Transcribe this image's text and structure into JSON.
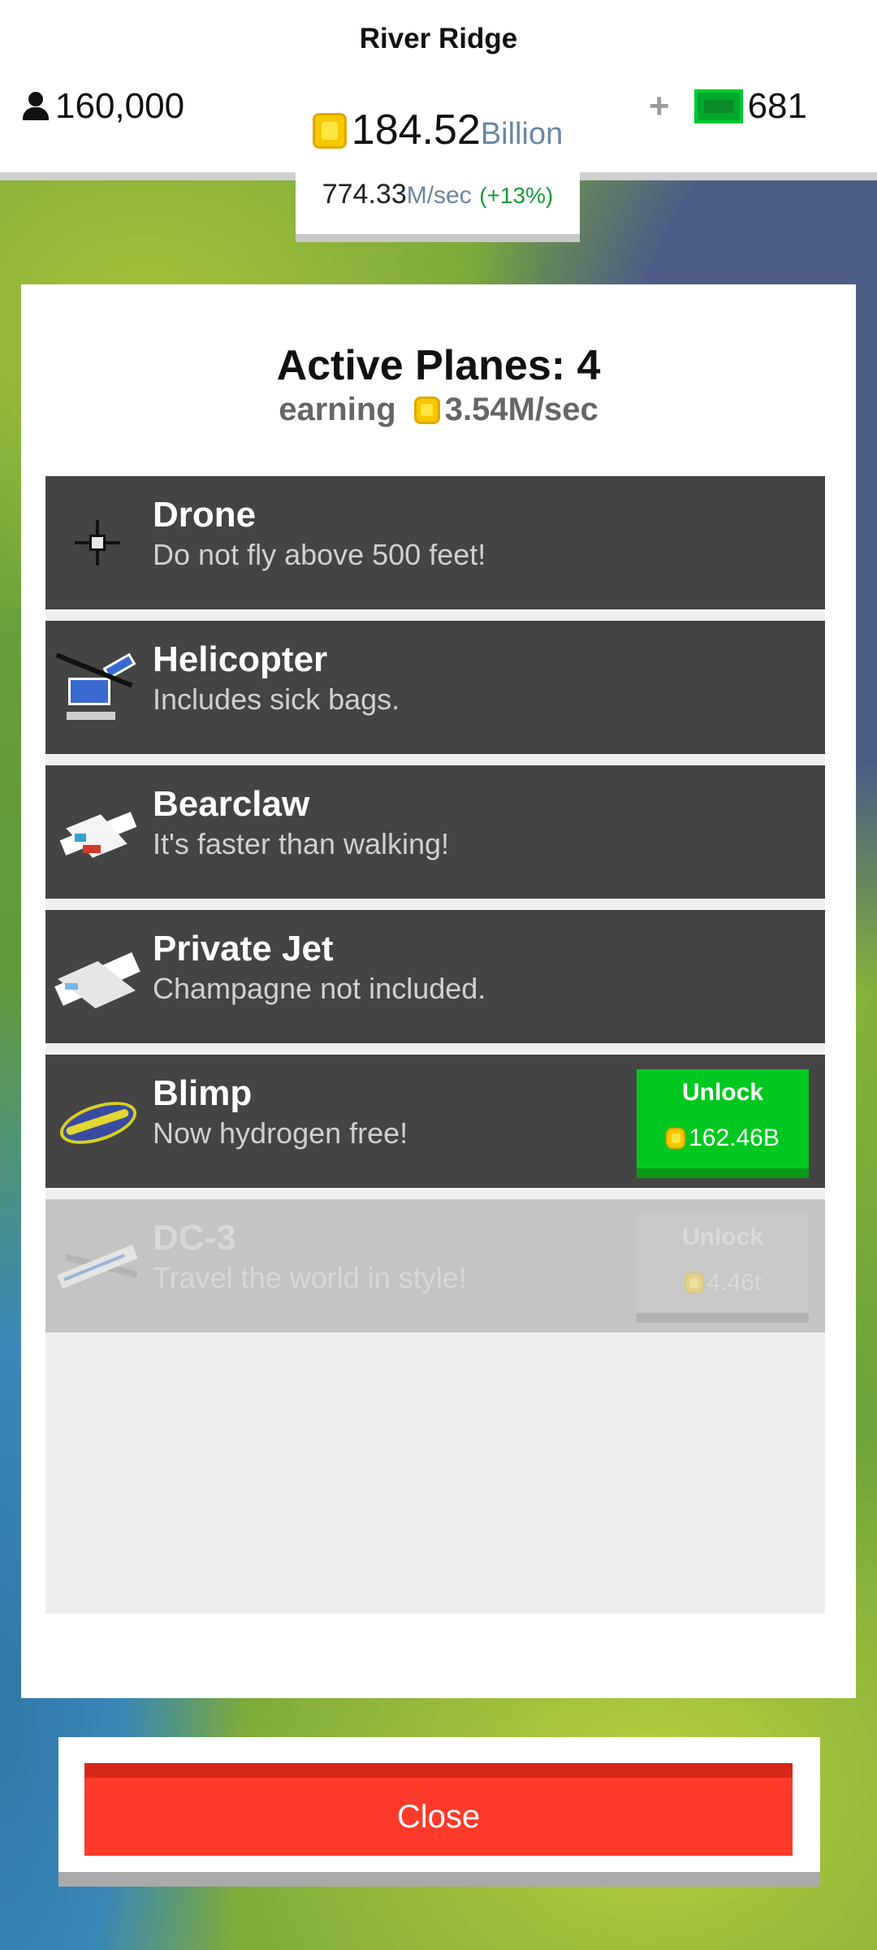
{
  "header": {
    "city_name": "River Ridge",
    "population": "160,000",
    "cash_plus": "+",
    "cash": "681",
    "money_value": "184.52",
    "money_unit": "Billion",
    "rate_value": "774.33",
    "rate_unit": "M/sec",
    "rate_percent": "(+13%)"
  },
  "panel": {
    "title": "Active Planes: 4",
    "earning_label": "earning",
    "earning_value": "3.54M/sec"
  },
  "planes": [
    {
      "name": "Drone",
      "desc": "Do not fly above 500 feet!",
      "icon": "drone-icon"
    },
    {
      "name": "Helicopter",
      "desc": "Includes sick bags.",
      "icon": "helicopter-icon"
    },
    {
      "name": "Bearclaw",
      "desc": "It's faster than walking!",
      "icon": "bearclaw-plane-icon"
    },
    {
      "name": "Private Jet",
      "desc": "Champagne not included.",
      "icon": "private-jet-icon"
    },
    {
      "name": "Blimp",
      "desc": "Now hydrogen free!",
      "icon": "blimp-icon",
      "unlock_label": "Unlock",
      "unlock_price": "162.46B"
    },
    {
      "name": "DC-3",
      "desc": "Travel the world in style!",
      "icon": "dc3-plane-icon",
      "unlock_label": "Unlock",
      "unlock_price": "4.46t"
    }
  ],
  "close_label": "Close",
  "colors": {
    "row_bg": "#444444",
    "unlock_green": "#00c820",
    "close_red": "#ff3a2a",
    "coin_gold": "#f6c800"
  }
}
